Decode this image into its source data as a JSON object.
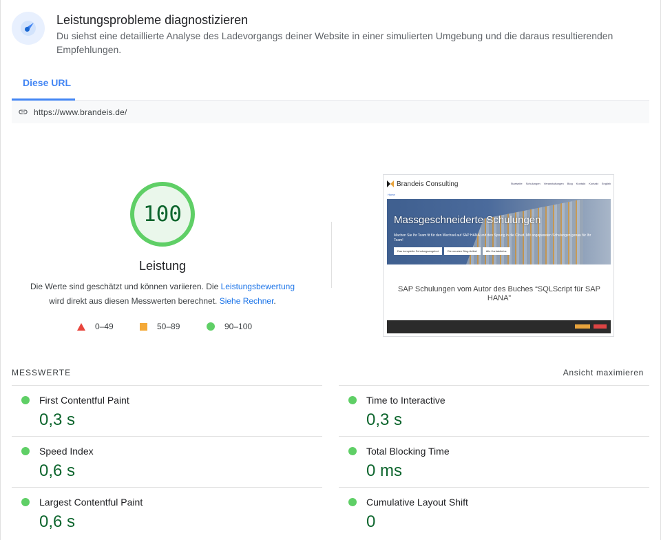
{
  "header": {
    "title": "Leistungsprobleme diagnostizieren",
    "description": "Du siehst eine detaillierte Analyse des Ladevorgangs deiner Website in einer simulierten Umgebung und die daraus resultierenden Empfehlungen.",
    "icon": "speedometer-icon"
  },
  "tabs": [
    {
      "label": "Diese URL",
      "active": true
    }
  ],
  "urlbar": {
    "icon": "link-icon",
    "url": "https://www.brandeis.de/"
  },
  "score": {
    "value": "100",
    "label": "Leistung",
    "desc_part1": "Die Werte sind geschätzt und können variieren. Die ",
    "link_scoring": "Leistungsbewertung",
    "desc_part2": " wird direkt aus diesen Messwerten berechnet. ",
    "link_calculator": "Siehe Rechner",
    "desc_part3": ".",
    "legend": [
      {
        "shape": "triangle",
        "range": "0–49",
        "color": "#e8453c"
      },
      {
        "shape": "square",
        "range": "50–89",
        "color": "#f4a938"
      },
      {
        "shape": "circle",
        "range": "90–100",
        "color": "#5fcf66"
      }
    ],
    "gauge_color": "#5fcf66",
    "gauge_fill": "#eaf7eb"
  },
  "thumbnail": {
    "brand": "Brandeis Consulting",
    "nav_links": [
      "Startseite",
      "Schulungen",
      "Veranstaltungen",
      "Blog",
      "Kontakt",
      "Kontakt",
      "English"
    ],
    "breadcrumb": "Home",
    "hero_title": "Massgeschneiderte Schulungen",
    "hero_text": "Machen Sie Ihr Team fit für den Wechsel auf SAP HANA und den Sprung in die Cloud. Mit angepassten Schulungen genau für Ihr Team!",
    "hero_buttons": [
      "Das komplette Schulungsangebot",
      "Die neusten Blog-Artikel",
      "Alle Kontaktinfos"
    ],
    "caption": "SAP Schulungen vom Autor des Buches “SQLScript für SAP HANA”"
  },
  "metrics": {
    "title": "MESSWERTE",
    "toggle_label": "Ansicht maximieren",
    "status_color": "#5fcf66",
    "items": [
      {
        "label": "First Contentful Paint",
        "value": "0,3 s"
      },
      {
        "label": "Time to Interactive",
        "value": "0,3 s"
      },
      {
        "label": "Speed Index",
        "value": "0,6 s"
      },
      {
        "label": "Total Blocking Time",
        "value": "0 ms"
      },
      {
        "label": "Largest Contentful Paint",
        "value": "0,6 s"
      },
      {
        "label": "Cumulative Layout Shift",
        "value": "0"
      }
    ]
  }
}
